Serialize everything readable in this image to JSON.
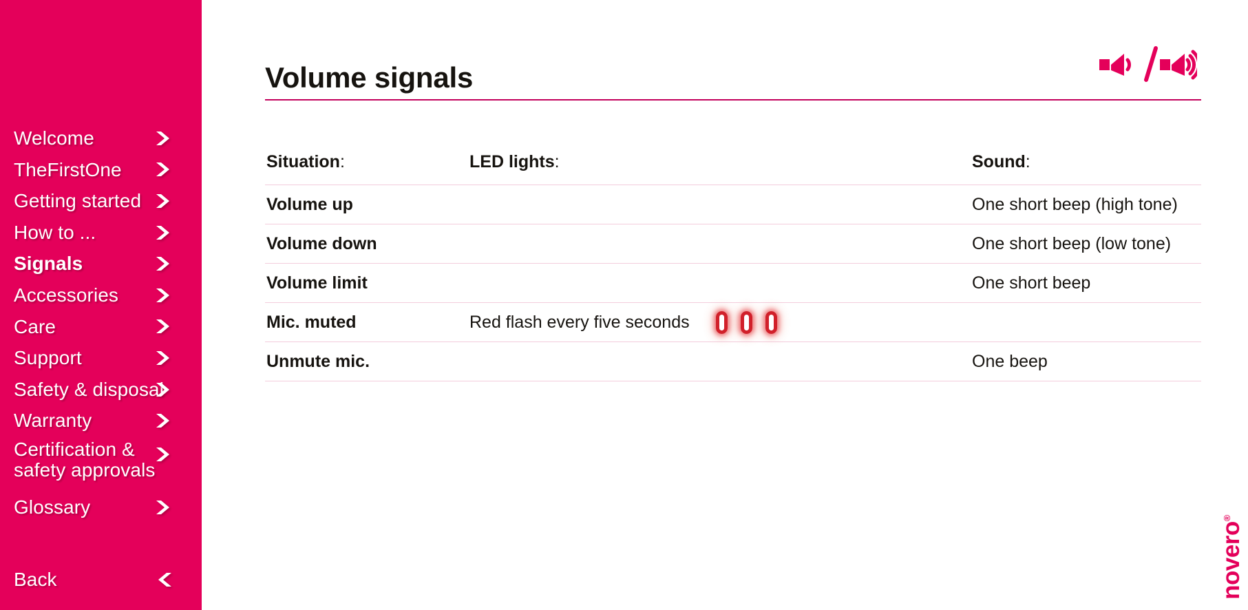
{
  "colors": {
    "sidebar_bg": "#e4005a",
    "accent_rule": "#c3005c",
    "row_rule": "#f3ccdc",
    "led_red": "#d1202a",
    "brand_pink": "#e4005a",
    "text": "#16130f"
  },
  "sidebar": {
    "items": [
      {
        "label": "Welcome",
        "icon": "chevron-right-icon",
        "active": false
      },
      {
        "label": "TheFirstOne",
        "icon": "chevron-right-icon",
        "active": false
      },
      {
        "label": "Getting started",
        "icon": "chevron-right-icon",
        "active": false
      },
      {
        "label": "How to ...",
        "icon": "chevron-right-icon",
        "active": false
      },
      {
        "label": "Signals",
        "icon": "chevron-right-icon",
        "active": true
      },
      {
        "label": "Accessories",
        "icon": "chevron-right-icon",
        "active": false
      },
      {
        "label": "Care",
        "icon": "chevron-right-icon",
        "active": false
      },
      {
        "label": "Support",
        "icon": "chevron-right-icon",
        "active": false
      },
      {
        "label": "Safety & disposal",
        "icon": "chevron-right-icon",
        "active": false
      },
      {
        "label": "Warranty",
        "icon": "chevron-right-icon",
        "active": false
      },
      {
        "label": "Certification &\nsafety approvals",
        "icon": "chevron-right-icon",
        "active": false
      },
      {
        "label": "Glossary",
        "icon": "chevron-right-icon",
        "active": false
      }
    ],
    "back": {
      "label": "Back",
      "icon": "chevron-left-icon"
    }
  },
  "header": {
    "title": "Volume signals",
    "icon": "volume-low-high-icon"
  },
  "table": {
    "headers": {
      "situation": "Situation",
      "led": "LED lights",
      "sound": "Sound",
      "colon": ":"
    },
    "rows": [
      {
        "situation": "Volume up",
        "led_text": "",
        "led_lamps": 0,
        "sound": "One short beep (high tone)"
      },
      {
        "situation": "Volume down",
        "led_text": "",
        "led_lamps": 0,
        "sound": "One short beep (low tone)"
      },
      {
        "situation": "Volume limit",
        "led_text": "",
        "led_lamps": 0,
        "sound": "One short beep"
      },
      {
        "situation": "Mic. muted",
        "led_text": "Red flash every five seconds",
        "led_lamps": 3,
        "sound": ""
      },
      {
        "situation": "Unmute mic.",
        "led_text": "",
        "led_lamps": 0,
        "sound": "One beep"
      }
    ]
  },
  "brand": {
    "name": "novero",
    "trademark": "®"
  }
}
